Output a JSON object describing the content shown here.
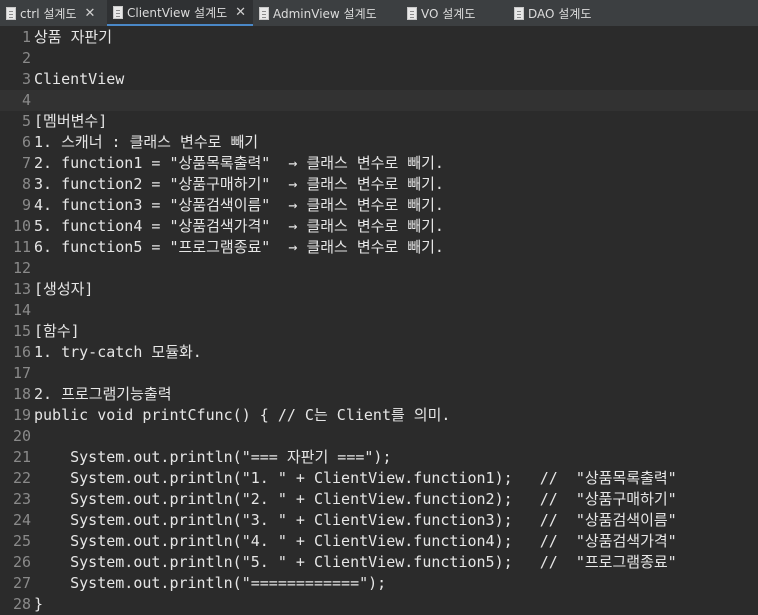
{
  "tabs": [
    {
      "label": "ctrl 설계도",
      "active": false,
      "closable": true,
      "width": 107
    },
    {
      "label": "ClientView 설계도",
      "active": true,
      "closable": true,
      "width": 146
    },
    {
      "label": "AdminView 설계도",
      "active": false,
      "closable": false,
      "width": 148
    },
    {
      "label": "VO 설계도",
      "active": false,
      "closable": false,
      "width": 107
    },
    {
      "label": "DAO 설계도",
      "active": false,
      "closable": false,
      "width": 120
    }
  ],
  "editor": {
    "current_line": 4,
    "lines": [
      "상품 자판기",
      "",
      "ClientView",
      "",
      "[멤버변수]",
      "1. 스캐너 : 클래스 변수로 빼기",
      "2. function1 = \"상품목록출력\"  → 클래스 변수로 빼기.",
      "3. function2 = \"상품구매하기\"  → 클래스 변수로 빼기.",
      "4. function3 = \"상품검색이름\"  → 클래스 변수로 빼기.",
      "5. function4 = \"상품검색가격\"  → 클래스 변수로 빼기.",
      "6. function5 = \"프로그램종료\"  → 클래스 변수로 빼기.",
      "",
      "[생성자]",
      "",
      "[함수]",
      "1. try-catch 모듈화.",
      "",
      "2. 프로그램기능출력",
      "public void printCfunc() { // C는 Client를 의미.",
      "",
      "    System.out.println(\"=== 자판기 ===\");",
      "    System.out.println(\"1. \" + ClientView.function1);   //  \"상품목록출력\"",
      "    System.out.println(\"2. \" + ClientView.function2);   //  \"상품구매하기\"",
      "    System.out.println(\"3. \" + ClientView.function3);   //  \"상품검색이름\"",
      "    System.out.println(\"4. \" + ClientView.function4);   //  \"상품검색가격\"",
      "    System.out.println(\"5. \" + ClientView.function5);   //  \"프로그램종료\"",
      "    System.out.println(\"============\");",
      "}"
    ]
  }
}
